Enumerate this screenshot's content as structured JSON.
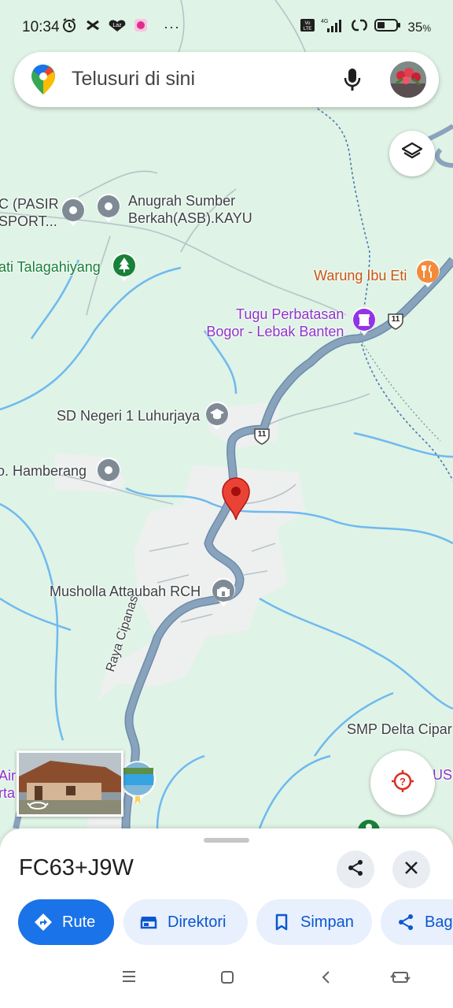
{
  "status_bar": {
    "time": "10:34",
    "battery_percent": "35",
    "battery_suffix": "%",
    "network": "4G",
    "volte": "Vo LTE",
    "more": "···"
  },
  "search": {
    "placeholder": "Telusuri di sini"
  },
  "map_labels": {
    "pasir_sport_line1": "C (PASIR",
    "pasir_sport_line2": "SPORT...",
    "anugrah_line1": "Anugrah Sumber",
    "anugrah_line2": "Berkah(ASB).KAYU",
    "talagahiyang": "ati Talagahiyang",
    "warung": "Warung Ibu Eti",
    "tugu_line1": "Tugu Perbatasan",
    "tugu_line2": "Bogor - Lebak Banten",
    "sd_negeri": "SD Negeri 1 Luhurjaya",
    "hamberang": "o. Hamberang",
    "musholla": "Musholla Attaubah RCH",
    "road_name": "Raya Cipanas",
    "smp": "SMP Delta Cipar",
    "air_line1": "Air",
    "air_line2": "rta",
    "us_partial": "US",
    "route_shield_1": "11",
    "route_shield_2": "11"
  },
  "bottom_sheet": {
    "plus_code": "FC63+J9W",
    "chips": [
      {
        "label": "Rute",
        "icon": "directions-icon"
      },
      {
        "label": "Direktori",
        "icon": "directory-icon"
      },
      {
        "label": "Simpan",
        "icon": "bookmark-icon"
      },
      {
        "label": "Bag",
        "icon": "share-icon"
      }
    ]
  },
  "colors": {
    "accent_blue": "#1a73e8",
    "road": "#8aa3bd",
    "water": "#5fb3f0",
    "land": "#dff3e6",
    "settlement": "#eef0ef",
    "pin_red": "#ea4335"
  }
}
